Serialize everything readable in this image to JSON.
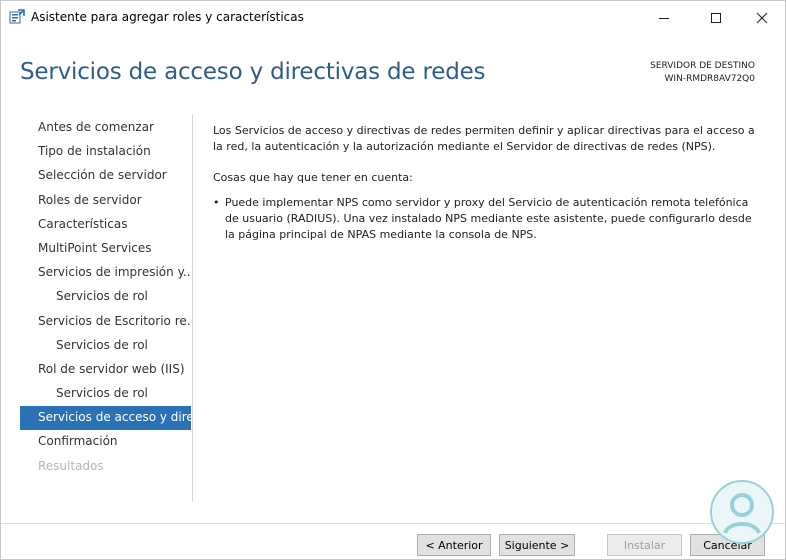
{
  "window": {
    "title": "Asistente para agregar roles y características",
    "controls": {
      "minimize": "—",
      "maximize": "☐",
      "close": "✕"
    }
  },
  "header": {
    "title": "Servicios de acceso y directivas de redes",
    "destination_label": "SERVIDOR DE DESTINO",
    "destination_server": "WIN-RMDR8AV72Q0"
  },
  "nav": {
    "items": [
      {
        "label": "Antes de comenzar",
        "state": "normal"
      },
      {
        "label": "Tipo de instalación",
        "state": "normal"
      },
      {
        "label": "Selección de servidor",
        "state": "normal"
      },
      {
        "label": "Roles de servidor",
        "state": "normal"
      },
      {
        "label": "Características",
        "state": "normal"
      },
      {
        "label": "MultiPoint Services",
        "state": "normal"
      },
      {
        "label": "Servicios de impresión y...",
        "state": "normal"
      },
      {
        "label": "Servicios de rol",
        "state": "sub"
      },
      {
        "label": "Servicios de Escritorio re...",
        "state": "normal"
      },
      {
        "label": "Servicios de rol",
        "state": "sub"
      },
      {
        "label": "Rol de servidor web (IIS)",
        "state": "normal"
      },
      {
        "label": "Servicios de rol",
        "state": "sub"
      },
      {
        "label": "Servicios de acceso y dire...",
        "state": "active"
      },
      {
        "label": "Confirmación",
        "state": "normal"
      },
      {
        "label": "Resultados",
        "state": "disabled"
      }
    ]
  },
  "content": {
    "intro": "Los Servicios de acceso y directivas de redes permiten definir y aplicar directivas para el acceso a la red, la autenticación y la autorización mediante el Servidor de directivas de redes (NPS).",
    "notes_heading": "Cosas que hay que tener en cuenta:",
    "bullets": [
      "Puede implementar NPS como servidor y proxy del Servicio de autenticación remota telefónica de usuario (RADIUS). Una vez instalado NPS mediante este asistente, puede configurarlo desde la página principal de NPAS mediante la consola de NPS."
    ]
  },
  "footer": {
    "previous": "< Anterior",
    "next": "Siguiente >",
    "install": "Instalar",
    "cancel": "Cancelar"
  },
  "colors": {
    "accent": "#2a72b5",
    "title": "#2f5d86",
    "watermark": "#9bd0da"
  },
  "icons": {
    "app": "server-manager-icon",
    "watermark": "watermark-logo-icon"
  }
}
